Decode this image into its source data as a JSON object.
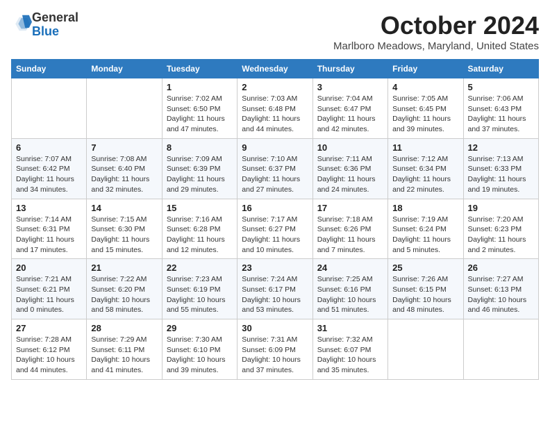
{
  "header": {
    "logo": {
      "general": "General",
      "blue": "Blue",
      "icon_alt": "GeneralBlue logo"
    },
    "month_title": "October 2024",
    "location": "Marlboro Meadows, Maryland, United States"
  },
  "calendar": {
    "days_of_week": [
      "Sunday",
      "Monday",
      "Tuesday",
      "Wednesday",
      "Thursday",
      "Friday",
      "Saturday"
    ],
    "weeks": [
      [
        {
          "day": null,
          "sunrise": null,
          "sunset": null,
          "daylight": null
        },
        {
          "day": null,
          "sunrise": null,
          "sunset": null,
          "daylight": null
        },
        {
          "day": 1,
          "sunrise": "Sunrise: 7:02 AM",
          "sunset": "Sunset: 6:50 PM",
          "daylight": "Daylight: 11 hours and 47 minutes."
        },
        {
          "day": 2,
          "sunrise": "Sunrise: 7:03 AM",
          "sunset": "Sunset: 6:48 PM",
          "daylight": "Daylight: 11 hours and 44 minutes."
        },
        {
          "day": 3,
          "sunrise": "Sunrise: 7:04 AM",
          "sunset": "Sunset: 6:47 PM",
          "daylight": "Daylight: 11 hours and 42 minutes."
        },
        {
          "day": 4,
          "sunrise": "Sunrise: 7:05 AM",
          "sunset": "Sunset: 6:45 PM",
          "daylight": "Daylight: 11 hours and 39 minutes."
        },
        {
          "day": 5,
          "sunrise": "Sunrise: 7:06 AM",
          "sunset": "Sunset: 6:43 PM",
          "daylight": "Daylight: 11 hours and 37 minutes."
        }
      ],
      [
        {
          "day": 6,
          "sunrise": "Sunrise: 7:07 AM",
          "sunset": "Sunset: 6:42 PM",
          "daylight": "Daylight: 11 hours and 34 minutes."
        },
        {
          "day": 7,
          "sunrise": "Sunrise: 7:08 AM",
          "sunset": "Sunset: 6:40 PM",
          "daylight": "Daylight: 11 hours and 32 minutes."
        },
        {
          "day": 8,
          "sunrise": "Sunrise: 7:09 AM",
          "sunset": "Sunset: 6:39 PM",
          "daylight": "Daylight: 11 hours and 29 minutes."
        },
        {
          "day": 9,
          "sunrise": "Sunrise: 7:10 AM",
          "sunset": "Sunset: 6:37 PM",
          "daylight": "Daylight: 11 hours and 27 minutes."
        },
        {
          "day": 10,
          "sunrise": "Sunrise: 7:11 AM",
          "sunset": "Sunset: 6:36 PM",
          "daylight": "Daylight: 11 hours and 24 minutes."
        },
        {
          "day": 11,
          "sunrise": "Sunrise: 7:12 AM",
          "sunset": "Sunset: 6:34 PM",
          "daylight": "Daylight: 11 hours and 22 minutes."
        },
        {
          "day": 12,
          "sunrise": "Sunrise: 7:13 AM",
          "sunset": "Sunset: 6:33 PM",
          "daylight": "Daylight: 11 hours and 19 minutes."
        }
      ],
      [
        {
          "day": 13,
          "sunrise": "Sunrise: 7:14 AM",
          "sunset": "Sunset: 6:31 PM",
          "daylight": "Daylight: 11 hours and 17 minutes."
        },
        {
          "day": 14,
          "sunrise": "Sunrise: 7:15 AM",
          "sunset": "Sunset: 6:30 PM",
          "daylight": "Daylight: 11 hours and 15 minutes."
        },
        {
          "day": 15,
          "sunrise": "Sunrise: 7:16 AM",
          "sunset": "Sunset: 6:28 PM",
          "daylight": "Daylight: 11 hours and 12 minutes."
        },
        {
          "day": 16,
          "sunrise": "Sunrise: 7:17 AM",
          "sunset": "Sunset: 6:27 PM",
          "daylight": "Daylight: 11 hours and 10 minutes."
        },
        {
          "day": 17,
          "sunrise": "Sunrise: 7:18 AM",
          "sunset": "Sunset: 6:26 PM",
          "daylight": "Daylight: 11 hours and 7 minutes."
        },
        {
          "day": 18,
          "sunrise": "Sunrise: 7:19 AM",
          "sunset": "Sunset: 6:24 PM",
          "daylight": "Daylight: 11 hours and 5 minutes."
        },
        {
          "day": 19,
          "sunrise": "Sunrise: 7:20 AM",
          "sunset": "Sunset: 6:23 PM",
          "daylight": "Daylight: 11 hours and 2 minutes."
        }
      ],
      [
        {
          "day": 20,
          "sunrise": "Sunrise: 7:21 AM",
          "sunset": "Sunset: 6:21 PM",
          "daylight": "Daylight: 11 hours and 0 minutes."
        },
        {
          "day": 21,
          "sunrise": "Sunrise: 7:22 AM",
          "sunset": "Sunset: 6:20 PM",
          "daylight": "Daylight: 10 hours and 58 minutes."
        },
        {
          "day": 22,
          "sunrise": "Sunrise: 7:23 AM",
          "sunset": "Sunset: 6:19 PM",
          "daylight": "Daylight: 10 hours and 55 minutes."
        },
        {
          "day": 23,
          "sunrise": "Sunrise: 7:24 AM",
          "sunset": "Sunset: 6:17 PM",
          "daylight": "Daylight: 10 hours and 53 minutes."
        },
        {
          "day": 24,
          "sunrise": "Sunrise: 7:25 AM",
          "sunset": "Sunset: 6:16 PM",
          "daylight": "Daylight: 10 hours and 51 minutes."
        },
        {
          "day": 25,
          "sunrise": "Sunrise: 7:26 AM",
          "sunset": "Sunset: 6:15 PM",
          "daylight": "Daylight: 10 hours and 48 minutes."
        },
        {
          "day": 26,
          "sunrise": "Sunrise: 7:27 AM",
          "sunset": "Sunset: 6:13 PM",
          "daylight": "Daylight: 10 hours and 46 minutes."
        }
      ],
      [
        {
          "day": 27,
          "sunrise": "Sunrise: 7:28 AM",
          "sunset": "Sunset: 6:12 PM",
          "daylight": "Daylight: 10 hours and 44 minutes."
        },
        {
          "day": 28,
          "sunrise": "Sunrise: 7:29 AM",
          "sunset": "Sunset: 6:11 PM",
          "daylight": "Daylight: 10 hours and 41 minutes."
        },
        {
          "day": 29,
          "sunrise": "Sunrise: 7:30 AM",
          "sunset": "Sunset: 6:10 PM",
          "daylight": "Daylight: 10 hours and 39 minutes."
        },
        {
          "day": 30,
          "sunrise": "Sunrise: 7:31 AM",
          "sunset": "Sunset: 6:09 PM",
          "daylight": "Daylight: 10 hours and 37 minutes."
        },
        {
          "day": 31,
          "sunrise": "Sunrise: 7:32 AM",
          "sunset": "Sunset: 6:07 PM",
          "daylight": "Daylight: 10 hours and 35 minutes."
        },
        {
          "day": null,
          "sunrise": null,
          "sunset": null,
          "daylight": null
        },
        {
          "day": null,
          "sunrise": null,
          "sunset": null,
          "daylight": null
        }
      ]
    ]
  }
}
